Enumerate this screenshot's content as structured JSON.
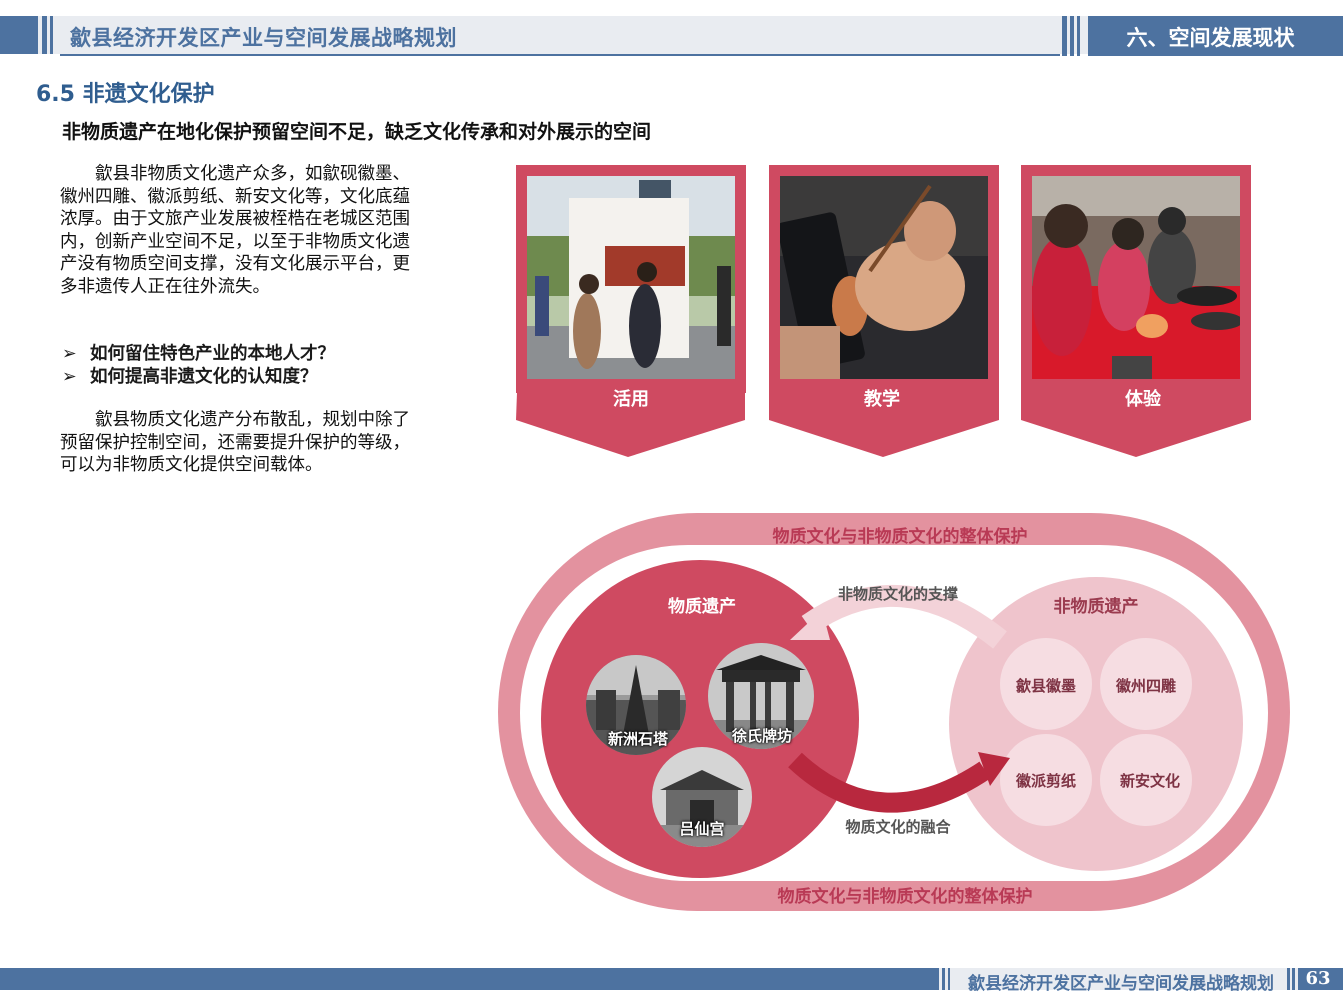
{
  "header": {
    "doc_title": "歙县经济开发区产业与空间发展战略规划",
    "section": "六、空间发展现状"
  },
  "section_title": "6.5 非遗文化保护",
  "subtitle": "非物质遗产在地化保护预留空间不足，缺乏文化传承和对外展示的空间",
  "paragraph1": "歙县非物质文化遗产众多，如歙砚徽墨、徽州四雕、徽派剪纸、新安文化等，文化底蕴浓厚。由于文旅产业发展被桎梏在老城区范围内，创新产业空间不足，以至于非物质文化遗产没有物质空间支撑，没有文化展示平台，更多非遗传人正在往外流失。",
  "bullets": [
    "如何留住特色产业的本地人才？",
    "如何提高非遗文化的认知度？"
  ],
  "bullet_marker": "➢",
  "paragraph2": "歙县物质文化遗产分布散乱，规划中除了预留保护控制空间，还需要提升保护的等级，可以为非物质文化提供空间载体。",
  "photo_cards": [
    {
      "label": "活用",
      "icon": "exhibition-photo"
    },
    {
      "label": "教学",
      "icon": "ink-painting-photo"
    },
    {
      "label": "体验",
      "icon": "inkstone-workshop-photo"
    }
  ],
  "diagram": {
    "outer_label_top": "物质文化与非物质文化的整体保护",
    "outer_label_bottom": "物质文化与非物质文化的整体保护",
    "material": {
      "title": "物质遗产",
      "sites": [
        "新洲石塔",
        "徐氏牌坊",
        "吕仙宫"
      ]
    },
    "intangible": {
      "title": "非物质遗产",
      "items": [
        "歙县徽墨",
        "徽州四雕",
        "徽派剪纸",
        "新安文化"
      ]
    },
    "support_label": "非物质文化的支撑",
    "fusion_label": "物质文化的融合"
  },
  "footer": {
    "doc_title": "歙县经济开发区产业与空间发展战略规划",
    "page": "63"
  },
  "colors": {
    "header_blue": "#4d72a0",
    "accent_red": "#cf4a61",
    "ring_pink": "#e3929f",
    "light_pink": "#efc4cc"
  }
}
